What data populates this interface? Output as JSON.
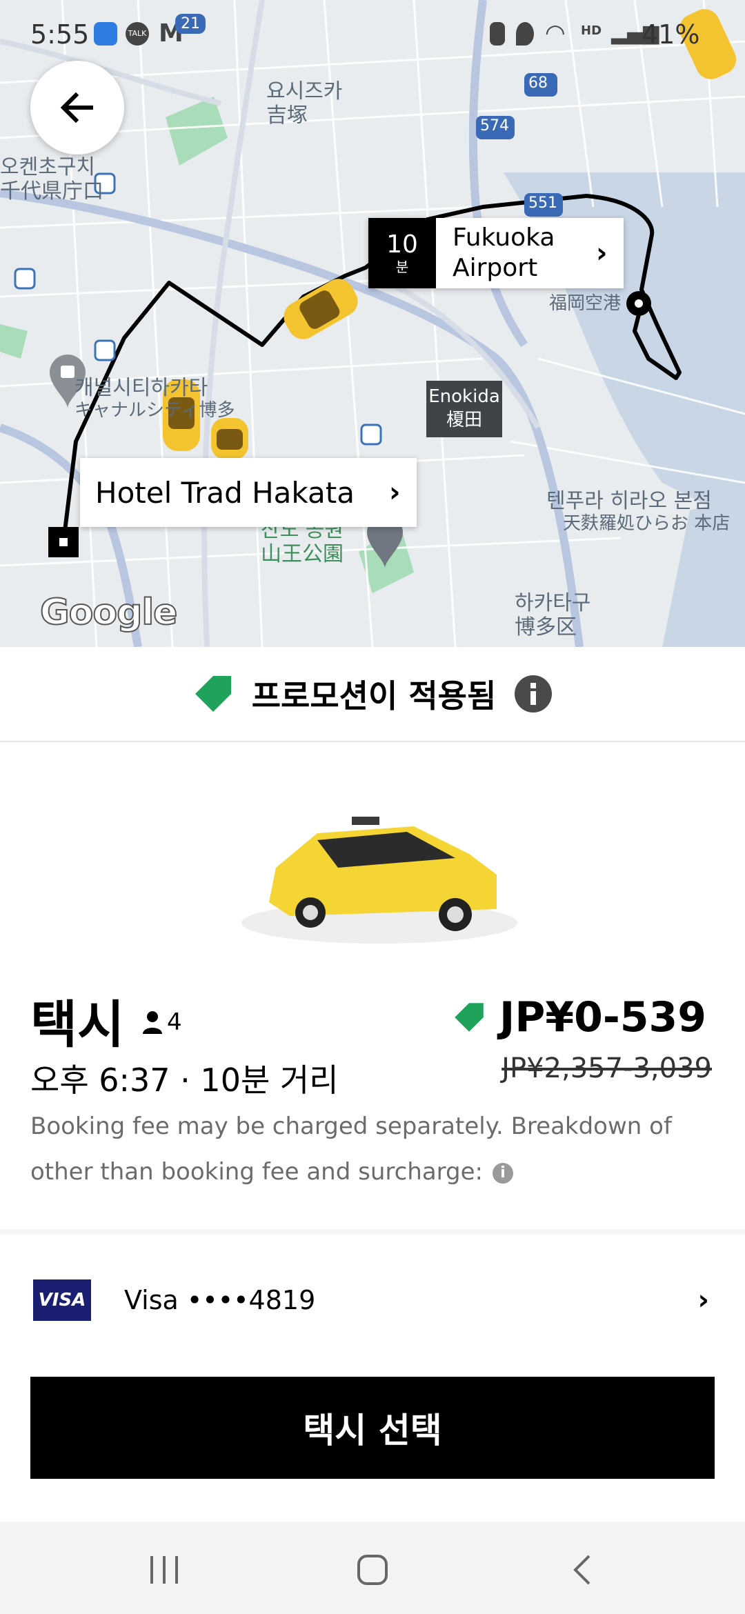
{
  "status_bar": {
    "time": "5:55",
    "battery": "41%",
    "gmail_badge": "21",
    "chat_badge": "TALK",
    "icons": [
      "kakao-icon",
      "talk-icon",
      "gmail-icon",
      "battery-saver-icon",
      "location-icon",
      "wifi-icon",
      "hd-voice-icon",
      "signal-icon"
    ]
  },
  "map": {
    "back_icon": "arrow-left-icon",
    "destination": {
      "eta_number": "10",
      "eta_unit": "분",
      "name": "Fukuoka Airport"
    },
    "origin": {
      "name": "Hotel Trad Hakata"
    },
    "poi_label": {
      "line1": "Enokida",
      "line2": "榎田"
    },
    "route_shields": [
      "68",
      "574",
      "551"
    ],
    "labels": {
      "yoshizuka_kr": "요시즈카",
      "yoshizuka_jp": "吉塚",
      "chiyo_kr": "오켄초구치",
      "chiyo_jp": "千代県庁口",
      "canal_kr": "캐널시티하카타",
      "canal_jp": "キャナルシティ博多",
      "tenpura_kr": "텐푸라 히라오 본점",
      "tenpura_jp": "天麩羅処ひらお 本店",
      "sanno_kr": "산노 공원",
      "sanno_jp": "山王公園",
      "hakata_kr": "하카타구",
      "hakata_jp": "博多区",
      "airport_jp": "福岡空港"
    },
    "attribution": "Google"
  },
  "promo": {
    "text": "프로모션이 적용됨",
    "tag_color": "#1fa35c"
  },
  "ride": {
    "name": "택시",
    "capacity": "4",
    "price": "JP¥0-539",
    "eta": "오후 6:37 · 10분 거리",
    "original_price": "JP¥2,357-3,039",
    "fee_note": "Booking fee may be charged separately. Breakdown of other than booking fee and surcharge:"
  },
  "payment": {
    "brand": "VISA",
    "label": "Visa ••••4819"
  },
  "select_button": {
    "label": "택시 선택"
  },
  "nav": {
    "icons": [
      "recent-apps-icon",
      "home-icon",
      "back-icon"
    ]
  }
}
